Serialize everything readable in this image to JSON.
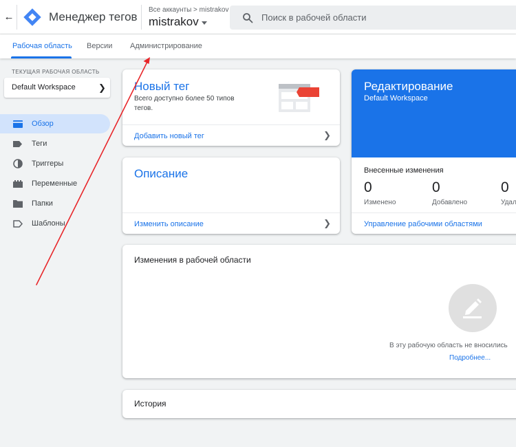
{
  "topbar": {
    "back_icon": "arrow-back-icon",
    "logo_icon": "tag-manager-logo",
    "app_title": "Менеджер тегов",
    "breadcrumb": "Все аккаунты > mistrakov",
    "account_name": "mistrakov",
    "search_placeholder": "Поиск в рабочей области"
  },
  "tabs": [
    {
      "label": "Рабочая область",
      "active": true
    },
    {
      "label": "Версии",
      "active": false
    },
    {
      "label": "Администрирование",
      "active": false
    }
  ],
  "sidebar": {
    "workspace_caption": "ТЕКУЩАЯ РАБОЧАЯ ОБЛАСТЬ",
    "workspace_name": "Default Workspace",
    "items": [
      {
        "label": "Обзор",
        "icon": "overview-icon",
        "active": true
      },
      {
        "label": "Теги",
        "icon": "tag-icon",
        "active": false
      },
      {
        "label": "Триггеры",
        "icon": "trigger-icon",
        "active": false
      },
      {
        "label": "Переменные",
        "icon": "variables-icon",
        "active": false
      },
      {
        "label": "Папки",
        "icon": "folder-icon",
        "active": false
      },
      {
        "label": "Шаблоны",
        "icon": "template-icon",
        "active": false
      }
    ]
  },
  "new_tag_card": {
    "title": "Новый тег",
    "description": "Всего доступно более 50 типов тегов.",
    "link": "Добавить новый тег"
  },
  "description_card": {
    "title": "Описание",
    "link": "Изменить описание"
  },
  "editing_card": {
    "title": "Редактирование",
    "subtitle": "Default Workspace",
    "changes_caption": "Внесенные изменения",
    "stats": [
      {
        "value": "0",
        "label": "Изменено"
      },
      {
        "value": "0",
        "label": "Добавлено"
      },
      {
        "value": "0",
        "label": "Удал"
      }
    ],
    "link": "Управление рабочими областями"
  },
  "workspace_changes_card": {
    "title": "Изменения в рабочей области",
    "empty_icon": "edit-pencil-icon",
    "empty_text": "В эту рабочую область не вносились",
    "more_link": "Подробнее..."
  },
  "history_card": {
    "title": "История"
  },
  "colors": {
    "accent": "#1a73e8",
    "active_nav_bg": "#d2e3fc",
    "annotation_arrow": "#e8262a",
    "tag_illustration_red": "#ea4335"
  }
}
